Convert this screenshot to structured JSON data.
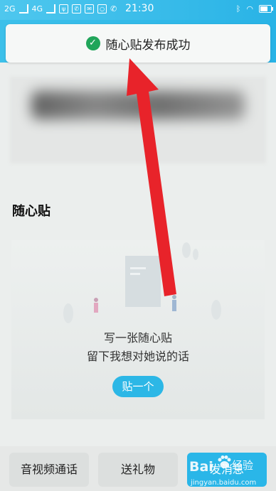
{
  "status_bar": {
    "network_1": "2G",
    "network_2": "4G",
    "time": "21:30"
  },
  "toast": {
    "message": "随心贴发布成功",
    "icon": "check-circle-icon",
    "icon_color": "#20a55a"
  },
  "section": {
    "title": "随心贴"
  },
  "empty_card": {
    "line1": "写一张随心贴",
    "line2": "留下我想对她说的话",
    "button_label": "贴一个"
  },
  "bottom_bar": {
    "buttons": [
      {
        "label": "音视频通话"
      },
      {
        "label": "送礼物"
      },
      {
        "label": "发消息"
      }
    ]
  },
  "watermark": {
    "brand": "Bai",
    "sub": "经验",
    "url": "jingyan.baidu.com"
  },
  "colors": {
    "accent": "#2cb7e6",
    "annotation_arrow": "#e8232a"
  }
}
